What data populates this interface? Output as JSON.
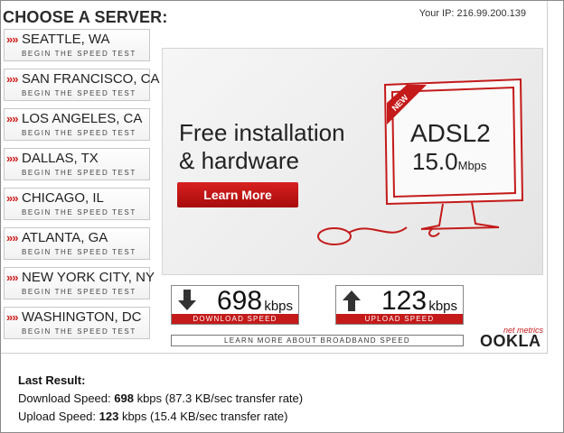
{
  "header": {
    "choose_label": "CHOOSE A SERVER:",
    "ip_text": "Your IP: 216.99.200.139"
  },
  "servers": [
    {
      "city": "SEATTLE, WA",
      "sub": "BEGIN THE SPEED TEST"
    },
    {
      "city": "SAN FRANCISCO, CA",
      "sub": "BEGIN THE SPEED TEST"
    },
    {
      "city": "LOS ANGELES, CA",
      "sub": "BEGIN THE SPEED TEST"
    },
    {
      "city": "DALLAS, TX",
      "sub": "BEGIN THE SPEED TEST"
    },
    {
      "city": "CHICAGO, IL",
      "sub": "BEGIN THE SPEED TEST"
    },
    {
      "city": "ATLANTA, GA",
      "sub": "BEGIN THE SPEED TEST"
    },
    {
      "city": "NEW YORK CITY, NY",
      "sub": "BEGIN THE SPEED TEST"
    },
    {
      "city": "WASHINGTON, DC",
      "sub": "BEGIN THE SPEED TEST"
    }
  ],
  "chevron": "»»",
  "ad": {
    "headline_1": "Free installation",
    "headline_2": "& hardware",
    "button": "Learn More",
    "badge": "NEW",
    "product": "ADSL2",
    "speed": "15.0",
    "speed_unit": "Mbps"
  },
  "download": {
    "value": "698",
    "unit": "kbps",
    "label": "DOWNLOAD SPEED"
  },
  "upload": {
    "value": "123",
    "unit": "kbps",
    "label": "UPLOAD SPEED"
  },
  "learn_more": "LEARN MORE ABOUT BROADBAND SPEED",
  "brand": {
    "tagline": "net metrics",
    "name": "OOKLA"
  },
  "result": {
    "title": "Last Result:",
    "download_prefix": "Download Speed: ",
    "download_value": "698",
    "download_suffix": " kbps (87.3 KB/sec transfer rate)",
    "upload_prefix": "Upload Speed: ",
    "upload_value": "123",
    "upload_suffix": " kbps (15.4 KB/sec transfer rate)"
  },
  "colors": {
    "accent": "#c41a1a"
  }
}
